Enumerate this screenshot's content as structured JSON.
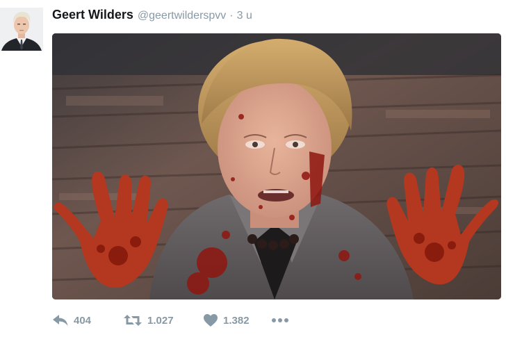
{
  "tweet": {
    "author": {
      "display_name": "Geert Wilders",
      "handle": "@geertwilderspvv",
      "separator": "·",
      "time": "3 u"
    },
    "actions": {
      "reply_count": "404",
      "retweet_count": "1.027",
      "like_count": "1.382",
      "more_label": "•••"
    },
    "icons": {
      "reply": "reply-icon",
      "retweet": "retweet-icon",
      "like": "heart-icon",
      "more": "more-icon"
    },
    "colors": {
      "name": "#14171a",
      "meta": "#8899a6",
      "icon": "#8899a6"
    }
  }
}
